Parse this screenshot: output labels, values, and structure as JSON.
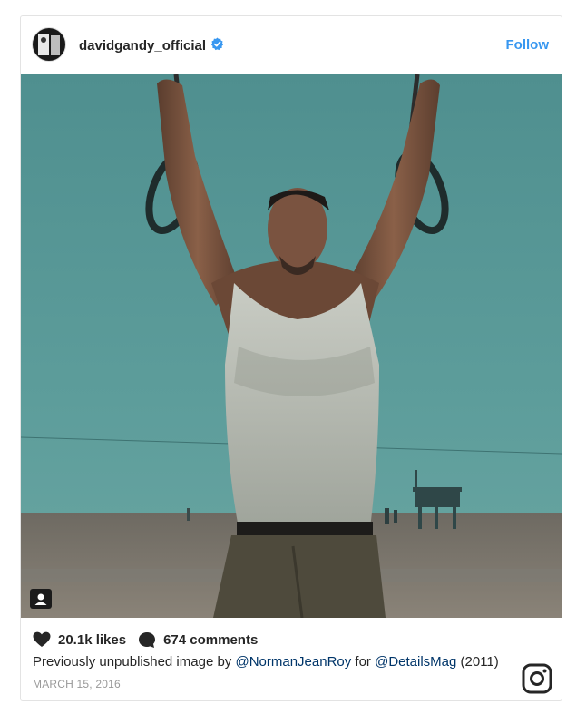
{
  "post": {
    "username": "davidgandy_official",
    "follow_label": "Follow",
    "likes": "20.1k likes",
    "comments": "674 comments",
    "caption": {
      "text_before": "Previously unpublished image by ",
      "mention_1": "@NormanJeanRoy",
      "text_middle": " for ",
      "mention_2": "@DetailsMag",
      "text_after": " (2011)"
    },
    "date": "MARCH 15, 2016"
  },
  "icons": {
    "verified": "verified-badge-icon",
    "like": "heart-icon",
    "comment": "comment-bubble-icon",
    "user_tag": "person-tag-icon",
    "instagram": "instagram-logo-icon"
  },
  "colors": {
    "accent": "#3897f0",
    "mention": "#003569",
    "text": "#262626",
    "muted": "#999999",
    "sky": "#4e8f8e"
  }
}
